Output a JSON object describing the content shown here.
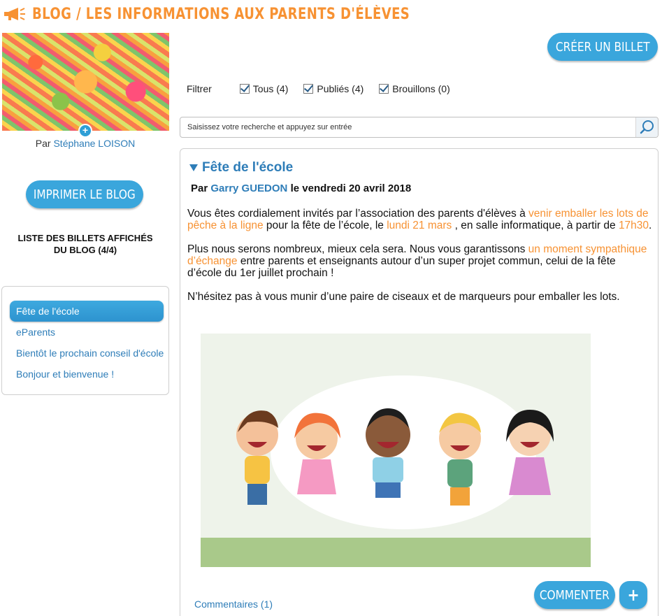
{
  "header": {
    "title": "BLOG / LES INFORMATIONS AUX PARENTS D'ÉLÈVES",
    "icon": "megaphone-icon",
    "accent": "#f79233"
  },
  "sidebar": {
    "author_prefix": "Par",
    "author_name": "Stéphane LOISON",
    "print_label": "IMPRIMER LE BLOG",
    "list_title_line1": "LISTE DES BILLETS AFFICHÉS",
    "list_title_line2": "DU BLOG (4/4)",
    "posts": [
      {
        "label": "Fête de l'école",
        "active": true
      },
      {
        "label": "eParents"
      },
      {
        "label": "Bientôt le prochain conseil d'école"
      },
      {
        "label": "Bonjour et bienvenue !"
      }
    ]
  },
  "toolbar": {
    "create_label": "CRÉER UN BILLET",
    "filter_label": "Filtrer",
    "filters": [
      {
        "label": "Tous (4)",
        "checked": true
      },
      {
        "label": "Publiés (4)",
        "checked": true
      },
      {
        "label": "Brouillons (0)",
        "checked": true
      }
    ],
    "search_placeholder": "Saisissez votre recherche et appuyez sur entrée"
  },
  "post": {
    "title": "Fête de l'école",
    "meta_prefix": "Par",
    "meta_author": "Garry GUEDON",
    "meta_date": "le vendredi 20 avril 2018",
    "p1_a": "Vous êtes cordialement invités par l’association des parents d'élèves à ",
    "p1_hl1": "venir emballer les lots de pêche à la ligne",
    "p1_b": " pour la fête de l’école, le ",
    "p1_hl2": "lundi 21 mars",
    "p1_c": " , en salle informatique, à partir de ",
    "p1_hl3": "17h30",
    "p1_d": ".",
    "p2_a": "Plus nous serons nombreux, mieux cela sera. Nous vous garantissons ",
    "p2_hl": "un moment sympathique d’échange",
    "p2_b": " entre parents et enseignants autour d’un super projet commun, celui de la fête d’école du 1er juillet prochain !",
    "p3": "N’hésitez pas à vous munir d’une paire de ciseaux et de marqueurs pour emballer les lots.",
    "comments_label": "Commentaires (1)",
    "comment_button": "COMMENTER",
    "plus_button": "+"
  }
}
